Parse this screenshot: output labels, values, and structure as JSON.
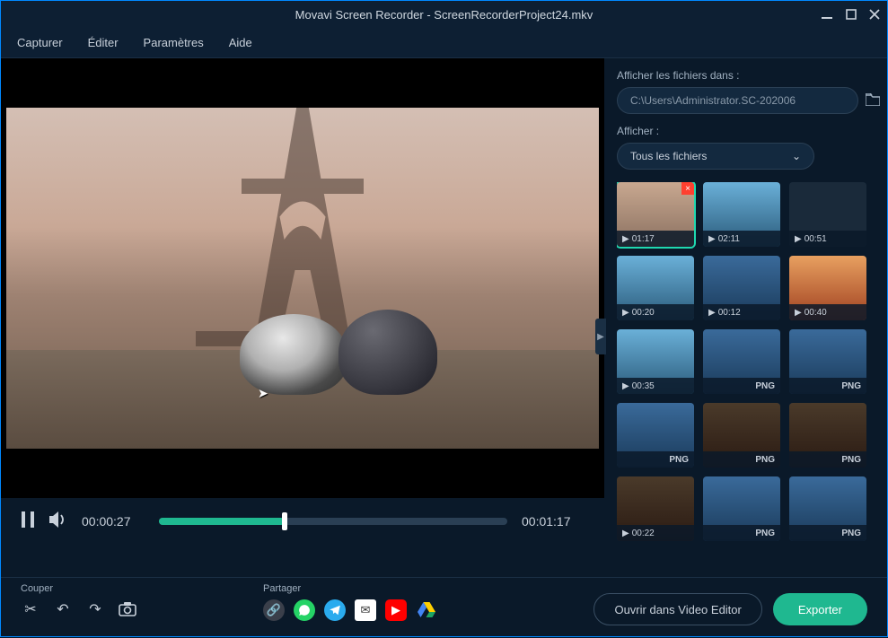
{
  "titlebar": {
    "title": "Movavi Screen Recorder - ScreenRecorderProject24.mkv"
  },
  "menu": {
    "capture": "Capturer",
    "edit": "Éditer",
    "settings": "Paramètres",
    "help": "Aide"
  },
  "transport": {
    "current": "00:00:27",
    "total": "00:01:17"
  },
  "toolbar": {
    "cut_label": "Couper",
    "share_label": "Partager"
  },
  "actions": {
    "open_editor": "Ouvrir dans Video Editor",
    "export": "Exporter"
  },
  "sidebar": {
    "show_in_label": "Afficher les fichiers dans :",
    "path": "C:\\Users\\Administrator.SC-202006",
    "show_label": "Afficher :",
    "filter_value": "Tous les fichiers",
    "thumbs": [
      {
        "type": "video",
        "time": "01:17",
        "img": "t-eiffel",
        "selected": true,
        "closable": true
      },
      {
        "type": "video",
        "time": "02:11",
        "img": "t-city"
      },
      {
        "type": "video",
        "time": "00:51",
        "img": "t-dark"
      },
      {
        "type": "video",
        "time": "00:20",
        "img": "t-city"
      },
      {
        "type": "video",
        "time": "00:12",
        "img": "t-desk"
      },
      {
        "type": "video",
        "time": "00:40",
        "img": "t-sun"
      },
      {
        "type": "video",
        "time": "00:35",
        "img": "t-city"
      },
      {
        "type": "png",
        "label": "PNG",
        "img": "t-desk"
      },
      {
        "type": "png",
        "label": "PNG",
        "img": "t-desk"
      },
      {
        "type": "png",
        "label": "PNG",
        "img": "t-desk"
      },
      {
        "type": "png",
        "label": "PNG",
        "img": "t-room"
      },
      {
        "type": "png",
        "label": "PNG",
        "img": "t-room"
      },
      {
        "type": "video",
        "time": "00:22",
        "img": "t-room"
      },
      {
        "type": "png",
        "label": "PNG",
        "img": "t-desk"
      },
      {
        "type": "png",
        "label": "PNG",
        "img": "t-desk"
      }
    ]
  }
}
